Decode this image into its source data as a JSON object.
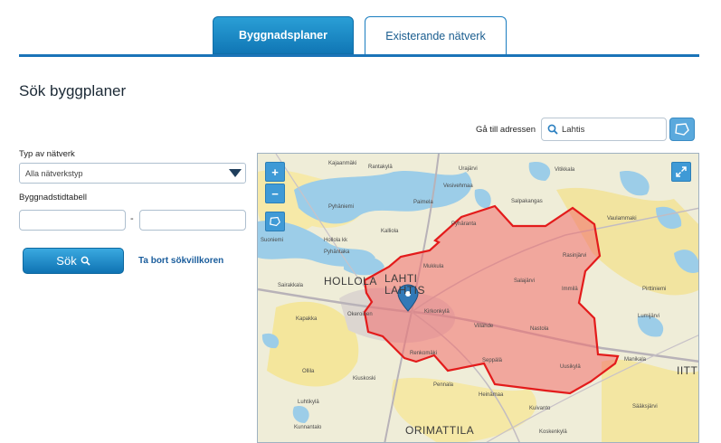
{
  "tabs": [
    {
      "label": "Byggnadsplaner",
      "active": true
    },
    {
      "label": "Existerande nätverk",
      "active": false
    }
  ],
  "page_title": "Sök byggplaner",
  "address": {
    "label": "Gå till adressen",
    "value": "Lahtis"
  },
  "filters": {
    "network_type_label": "Typ av nätverk",
    "network_type_value": "Alla nätverkstyp",
    "timetable_label": "Byggnadstidtabell",
    "date_separator": "-"
  },
  "actions": {
    "search_label": "Sök",
    "clear_label": "Ta bort sökvillkoren"
  },
  "map": {
    "zoom_in": "+",
    "zoom_out": "−",
    "big_labels": [
      "HOLLOLA",
      "LAHTI",
      "LAHTIS",
      "ORIMATTILA",
      "IITTI"
    ],
    "small_labels": [
      "Kajaanmäki",
      "Rantakylä",
      "Urajärvi",
      "Vitikkala",
      "Vesivehmaa",
      "Paimela",
      "Pyhäniemi",
      "Kalliola",
      "Suoniemi",
      "Hollola kk",
      "Salpakangas",
      "Pyhäranta",
      "Vaulammaki",
      "Pyhäntaka",
      "Sairakkala",
      "Okeroinen",
      "Kapakka",
      "Kirkonkylä",
      "Mukkula",
      "Renkomäki",
      "Villähde",
      "Nastola",
      "Seppälä",
      "Uusikylä",
      "Manikala",
      "Lumijärvi",
      "Kiuskoski",
      "Pennala",
      "Heinämaa",
      "Kuivanto",
      "Luhtikylä",
      "Ollila",
      "Koskenkylä",
      "Sääksjärvi",
      "Kunnantalo",
      "Immilä",
      "Salajärvi",
      "Rasinjärvi",
      "Pirttiniemi"
    ]
  },
  "colors": {
    "accent": "#1a73b8",
    "polygon_fill": "#f26d6d",
    "polygon_stroke": "#e31b1b"
  }
}
